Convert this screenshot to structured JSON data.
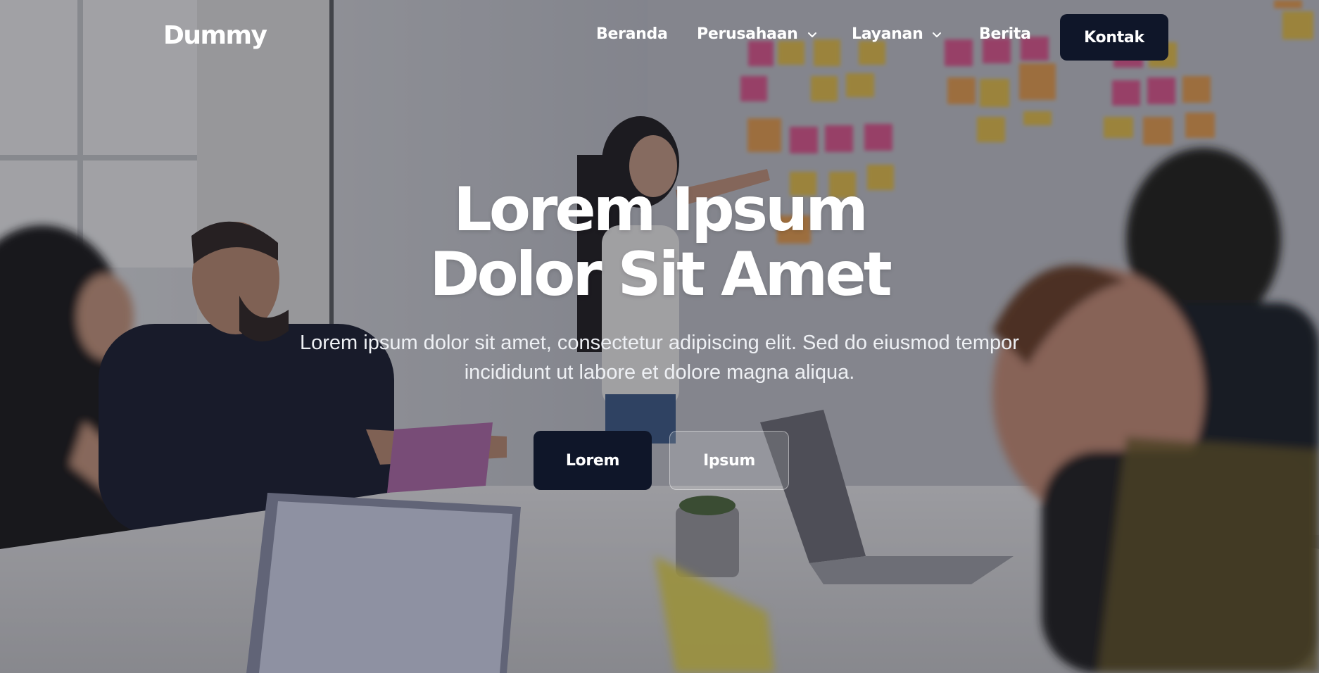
{
  "brand": {
    "logo_text": "Dummy"
  },
  "nav": {
    "items": [
      {
        "label": "Beranda",
        "has_dropdown": false
      },
      {
        "label": "Perusahaan",
        "has_dropdown": true
      },
      {
        "label": "Layanan",
        "has_dropdown": true
      },
      {
        "label": "Berita",
        "has_dropdown": false
      }
    ],
    "contact_label": "Kontak",
    "dropdown_icon": "chevron-down-icon"
  },
  "hero": {
    "title_line1": "Lorem Ipsum",
    "title_line2": "Dolor Sit Amet",
    "subtitle_line1": "Lorem ipsum dolor sit amet, consectetur adipiscing elit. Sed do eiusmod tempor",
    "subtitle_line2": "incididunt ut labore et dolore magna aliqua.",
    "primary_cta": "Lorem",
    "secondary_cta": "Ipsum",
    "background_image": "office-team-meeting-photo"
  },
  "colors": {
    "primary_dark": "#0f1629",
    "text_light": "#ffffff",
    "overlay": "rgba(28,30,40,0.38)"
  }
}
